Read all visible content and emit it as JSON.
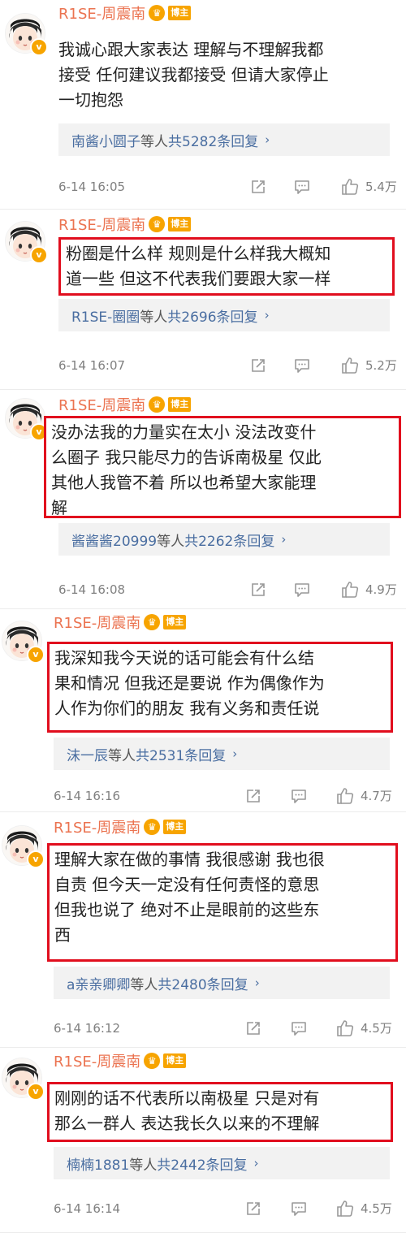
{
  "comments": [
    {
      "username": "R1SE-周震南",
      "badge": "博主",
      "text": "我诚心跟大家表达 理解与不理解我都\n接受 任何建议我都接受 但请大家停止\n一切抱怨",
      "reply_user": "南酱小圆子",
      "reply_mid": "等人",
      "reply_count": "共5282条回复",
      "time": "6-14 16:05",
      "likes": "5.4万"
    },
    {
      "username": "R1SE-周震南",
      "badge": "博主",
      "text": "粉圈是什么样 规则是什么样我大概知\n道一些 但这不代表我们要跟大家一样",
      "reply_user": "R1SE-圈圈",
      "reply_mid": "等人",
      "reply_count": "共2696条回复",
      "time": "6-14 16:07",
      "likes": "5.2万"
    },
    {
      "username": "R1SE-周震南",
      "badge": "博主",
      "text": "没办法我的力量实在太小 没法改变什\n么圈子 我只能尽力的告诉南极星 仅此\n其他人我管不着 所以也希望大家能理\n解",
      "reply_user": "酱酱酱20999",
      "reply_mid": "等人",
      "reply_count": "共2262条回复",
      "time": "6-14 16:08",
      "likes": "4.9万"
    },
    {
      "username": "R1SE-周震南",
      "badge": "博主",
      "text": "我深知我今天说的话可能会有什么结\n果和情况 但我还是要说 作为偶像作为\n人作为你们的朋友 我有义务和责任说",
      "reply_user": "沫一辰",
      "reply_mid": "等人",
      "reply_count": "共2531条回复",
      "time": "6-14 16:16",
      "likes": "4.7万"
    },
    {
      "username": "R1SE-周震南",
      "badge": "博主",
      "text": "理解大家在做的事情 我很感谢 我也很\n自责 但今天一定没有任何责怪的意思\n但我也说了 绝对不止是眼前的这些东\n西",
      "reply_user": "a亲亲卿卿",
      "reply_mid": "等人",
      "reply_count": "共2480条回复",
      "time": "6-14 16:12",
      "likes": "4.5万"
    },
    {
      "username": "R1SE-周震南",
      "badge": "博主",
      "text": "刚刚的话不代表所以南极星 只是对有\n那么一群人 表达我长久以来的不理解",
      "reply_user": "楠楠1881",
      "reply_mid": "等人",
      "reply_count": "共2442条回复",
      "time": "6-14 16:14",
      "likes": "4.5万"
    }
  ]
}
